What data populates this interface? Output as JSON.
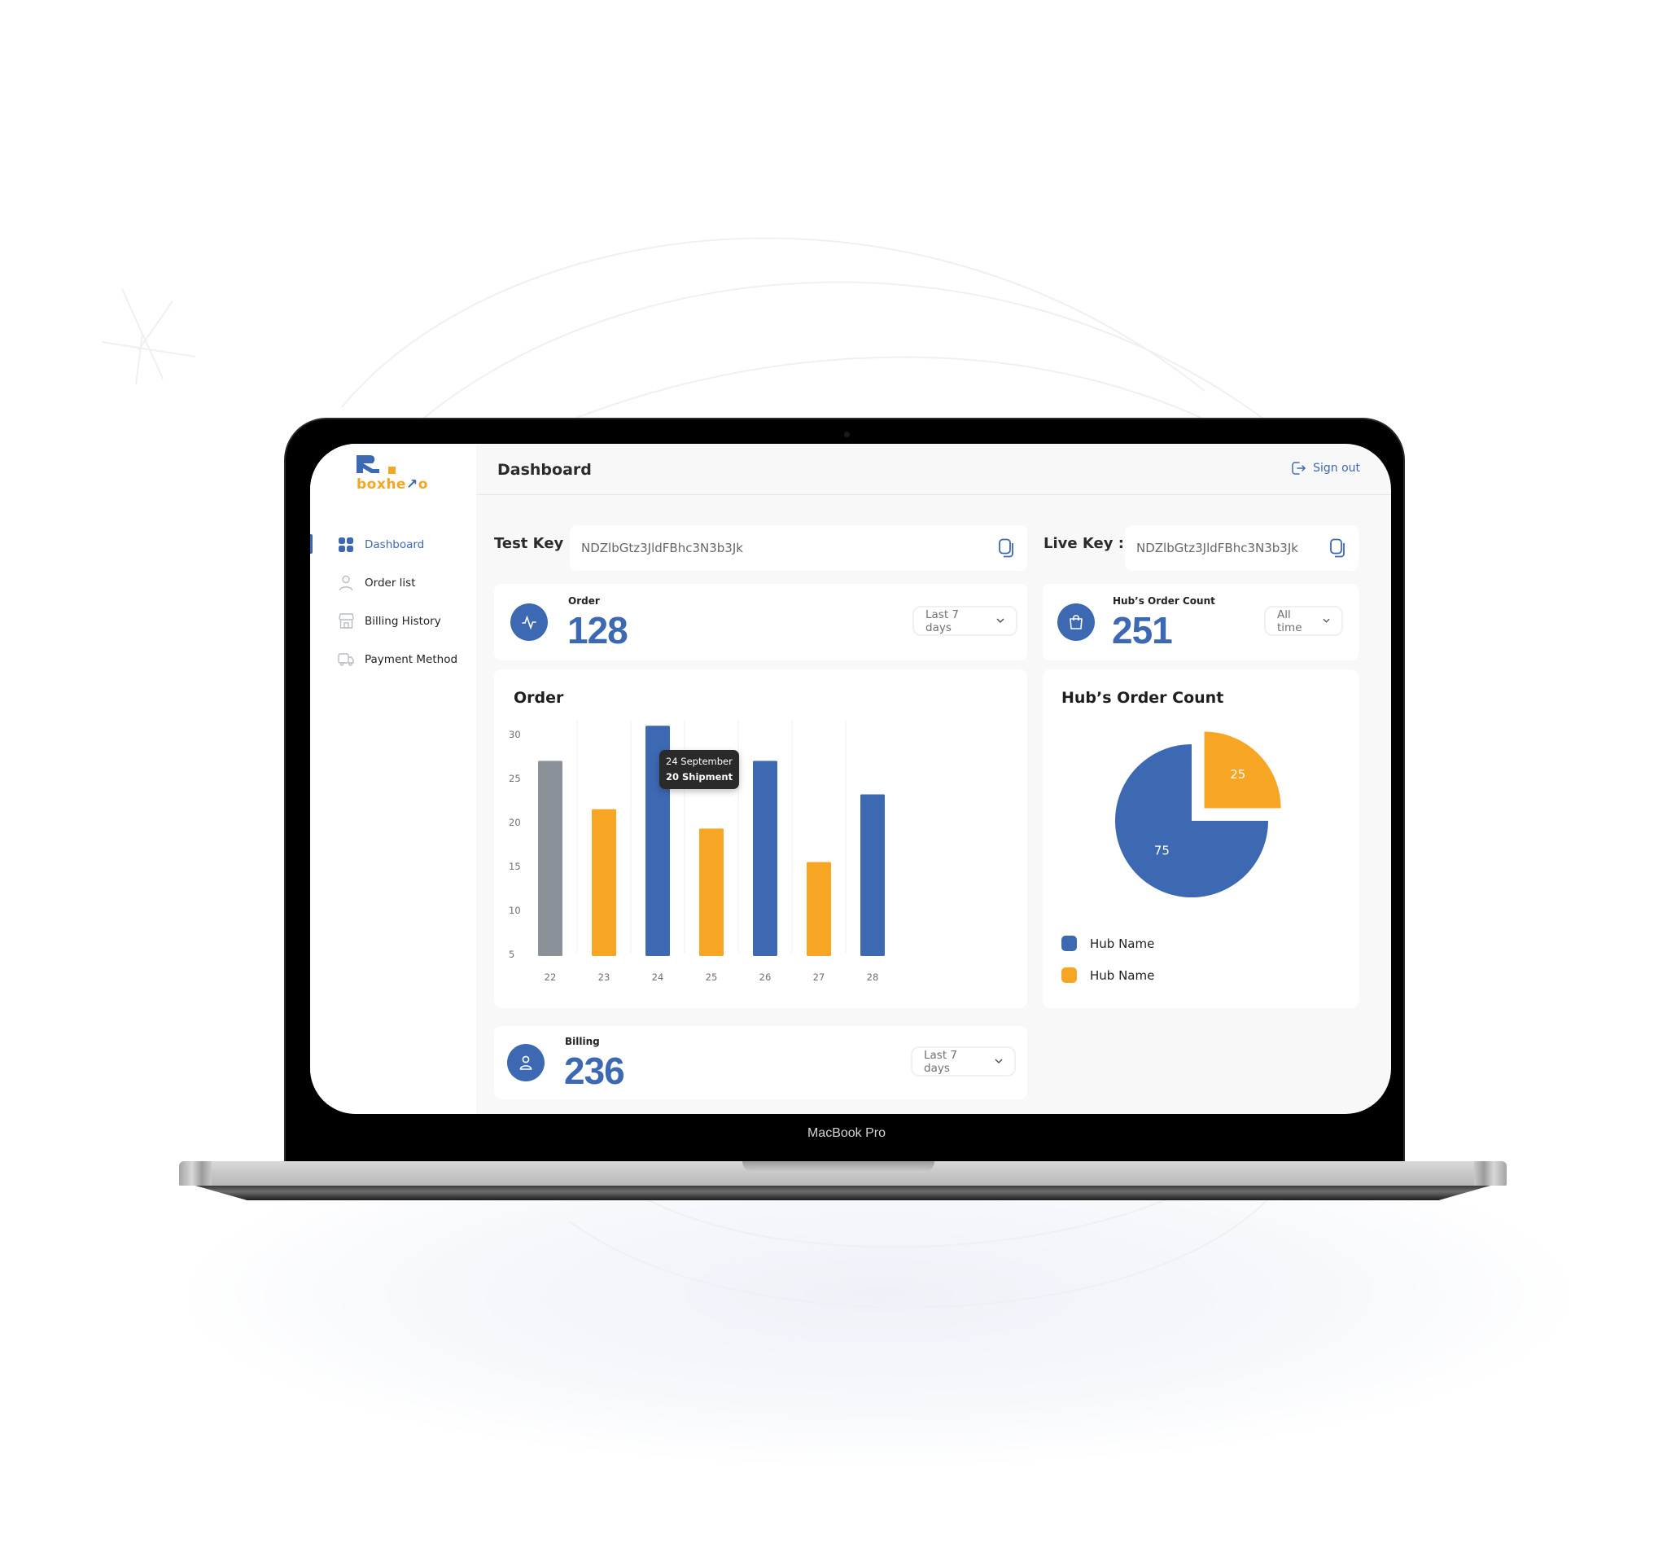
{
  "device": {
    "model_label": "MacBook Pro"
  },
  "brand": {
    "name_prefix": "boxhe",
    "name_arrow": "↗",
    "name_suffix": "o",
    "primary_color": "#3d68b2",
    "accent_color": "#f6a623"
  },
  "sidebar": {
    "items": [
      {
        "label": "Dashboard",
        "icon": "grid-icon",
        "active": true
      },
      {
        "label": "Order list",
        "icon": "user-icon",
        "active": false
      },
      {
        "label": "Billing History",
        "icon": "store-icon",
        "active": false
      },
      {
        "label": "Payment Method",
        "icon": "truck-icon",
        "active": false
      }
    ]
  },
  "header": {
    "title": "Dashboard",
    "signout_label": "Sign out"
  },
  "keys": {
    "test": {
      "label": "Test Key :",
      "value": "NDZlbGtz3JldFBhc3N3b3Jk"
    },
    "live": {
      "label": "Live Key :",
      "value": "NDZlbGtz3JldFBhc3N3b3Jk"
    }
  },
  "stats": {
    "order": {
      "label": "Order",
      "value": "128",
      "range": "Last 7 days"
    },
    "hub": {
      "label": "Hub’s Order Count",
      "value": "251",
      "range": "All time"
    },
    "billing": {
      "label": "Billing",
      "value": "236",
      "range": "Last 7 days"
    }
  },
  "chart_data": [
    {
      "type": "bar",
      "title": "Order",
      "categories": [
        "22",
        "23",
        "24",
        "25",
        "26",
        "27",
        "28"
      ],
      "values": [
        27,
        21.5,
        31,
        19.3,
        27,
        15.5,
        23.2
      ],
      "bar_colors": [
        "#8a9198",
        "#f6a623",
        "#3d68b2",
        "#f6a623",
        "#3d68b2",
        "#f6a623",
        "#3d68b2"
      ],
      "yticks": [
        30,
        25,
        20,
        15,
        10,
        5
      ],
      "ylim": [
        5,
        30
      ],
      "xlabel": "",
      "ylabel": "",
      "grid": "vertical",
      "tooltip": {
        "category": "24",
        "line1": "24 September",
        "line2": "20 Shipment"
      }
    },
    {
      "type": "pie",
      "title": "Hub’s Order Count",
      "slices": [
        {
          "name": "Hub Name",
          "value": 75,
          "label": "75",
          "color": "#3d68b2"
        },
        {
          "name": "Hub Name",
          "value": 25,
          "label": "25",
          "color": "#f6a623",
          "exploded": true
        }
      ],
      "legend": [
        "Hub Name",
        "Hub Name"
      ],
      "legend_position": "bottom-left"
    }
  ]
}
